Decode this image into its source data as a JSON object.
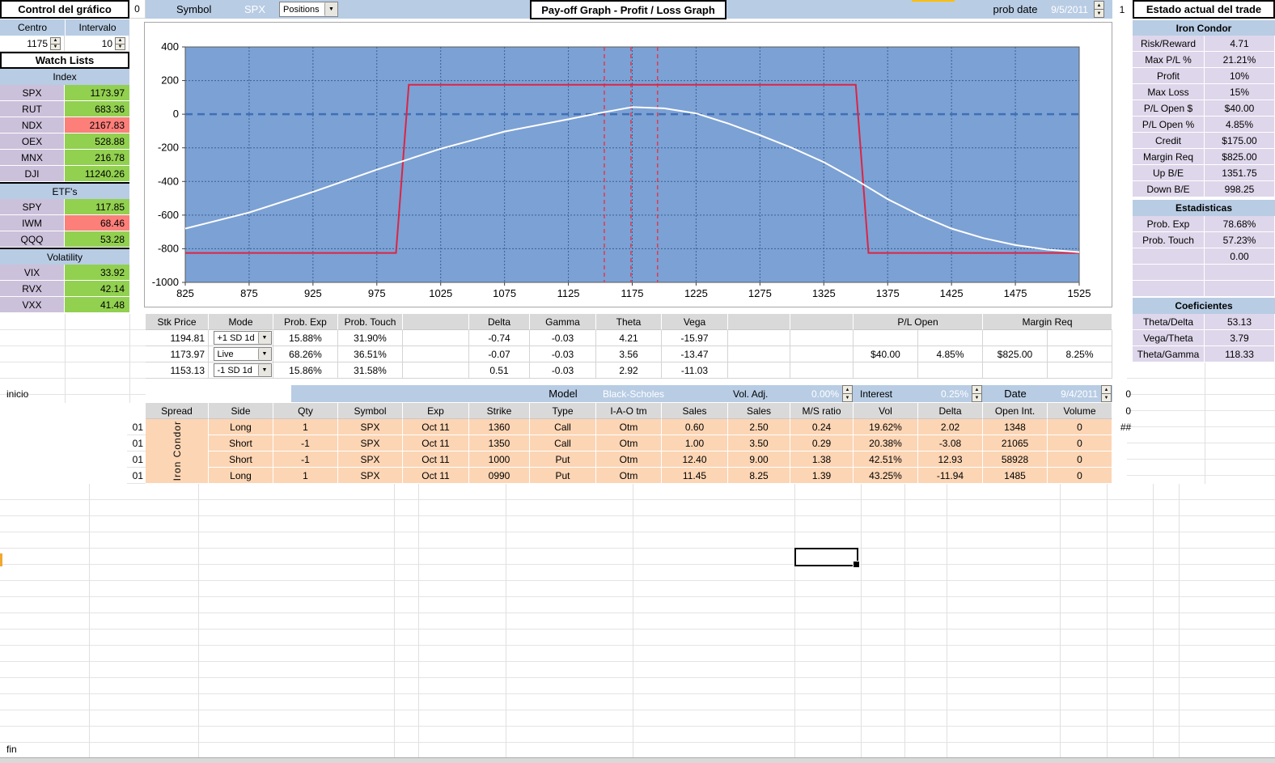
{
  "control_panel": {
    "title": "Control del gráfico",
    "adjacent_cell": "0",
    "centro": {
      "label": "Centro",
      "value": "1175"
    },
    "intervalo": {
      "label": "Intervalo",
      "value": "10"
    }
  },
  "watch_lists": {
    "title": "Watch Lists",
    "sections": [
      {
        "name": "Index",
        "rows": [
          [
            "SPX",
            "1173.97",
            "up"
          ],
          [
            "RUT",
            "683.36",
            "up"
          ],
          [
            "NDX",
            "2167.83",
            "down"
          ],
          [
            "OEX",
            "528.88",
            "up"
          ],
          [
            "MNX",
            "216.78",
            "up"
          ],
          [
            "DJI",
            "11240.26",
            "up"
          ]
        ]
      },
      {
        "name": "ETF's",
        "rows": [
          [
            "SPY",
            "117.85",
            "up"
          ],
          [
            "IWM",
            "68.46",
            "down"
          ],
          [
            "QQQ",
            "53.28",
            "up"
          ]
        ]
      },
      {
        "name": "Volatility",
        "rows": [
          [
            "VIX",
            "33.92",
            "up"
          ],
          [
            "RVX",
            "42.14",
            "up"
          ],
          [
            "VXX",
            "41.48",
            "up"
          ]
        ]
      }
    ]
  },
  "top_bar": {
    "symbol_label": "Symbol",
    "symbol_value": "SPX",
    "view_dropdown": "Positions",
    "graph_title": "Pay-off Graph - Profit / Loss Graph",
    "prob_date_label": "prob date",
    "prob_date_value": "9/5/2011",
    "corner_cell": "1"
  },
  "estado_panel": {
    "title": "Estado actual del trade",
    "strategy": "Iron Condor",
    "rows": [
      [
        "Risk/Reward",
        "4.71"
      ],
      [
        "Max P/L %",
        "21.21%"
      ],
      [
        "Profit",
        "10%"
      ],
      [
        "Max Loss",
        "15%"
      ],
      [
        "P/L Open $",
        "$40.00"
      ],
      [
        "P/L Open %",
        "4.85%"
      ],
      [
        "Credit",
        "$175.00"
      ],
      [
        "Margin Req",
        "$825.00"
      ],
      [
        "Up B/E",
        "1351.75"
      ],
      [
        "Down B/E",
        "998.25"
      ]
    ],
    "estadisticas": {
      "title": "Estadisticas",
      "rows": [
        [
          "Prob. Exp",
          "78.68%"
        ],
        [
          "Prob. Touch",
          "57.23%"
        ],
        [
          "",
          "0.00"
        ],
        [
          "",
          ""
        ],
        [
          "",
          ""
        ]
      ]
    },
    "coeficientes": {
      "title": "Coeficientes",
      "rows": [
        [
          "Theta/Delta",
          "53.13"
        ],
        [
          "Vega/Theta",
          "3.79"
        ],
        [
          "Theta/Gamma",
          "118.33"
        ]
      ]
    }
  },
  "chart_data": {
    "type": "line",
    "title": "Pay-off Graph - Profit / Loss Graph",
    "xlim": [
      825,
      1525
    ],
    "ylim": [
      -1000,
      400
    ],
    "x_tick_step": 50,
    "y_tick_step": 200,
    "plot_bg": "#7CA1D4",
    "grid_color": "#3A5F96",
    "zero_line": {
      "y": 0,
      "color": "#3F6FB5"
    },
    "price_markers": {
      "x": [
        1153.13,
        1173.97,
        1194.81
      ],
      "color": "#E03A50"
    },
    "series": [
      {
        "name": "expiration-payoff",
        "color": "#DC2444",
        "x": [
          825,
          990,
          1000,
          1350,
          1360,
          1525
        ],
        "y": [
          -825,
          -825,
          175,
          175,
          -825,
          -825
        ]
      },
      {
        "name": "current-pl",
        "color": "#FFFFFF",
        "x": [
          825,
          875,
          925,
          975,
          1025,
          1075,
          1125,
          1150,
          1175,
          1200,
          1225,
          1250,
          1275,
          1300,
          1325,
          1350,
          1375,
          1400,
          1425,
          1450,
          1475,
          1500,
          1525
        ],
        "y": [
          -680,
          -585,
          -462,
          -330,
          -205,
          -103,
          -30,
          8,
          42,
          35,
          5,
          -55,
          -125,
          -200,
          -285,
          -390,
          -505,
          -600,
          -680,
          -737,
          -778,
          -805,
          -820
        ]
      }
    ]
  },
  "greeks_table": {
    "headers": [
      "Stk Price",
      "Mode",
      "Prob. Exp",
      "Prob. Touch",
      "Delta",
      "Gamma",
      "Theta",
      "Vega",
      "P/L Open",
      "Margin Req"
    ],
    "rows": [
      {
        "stk": "1194.81",
        "mode": "+1 SD 1d",
        "prob_exp": "15.88%",
        "prob_touch": "31.90%",
        "delta": "-0.74",
        "gamma": "-0.03",
        "theta": "4.21",
        "vega": "-15.97",
        "pl_open_d": "",
        "pl_open_p": "",
        "margin_d": "",
        "margin_p": ""
      },
      {
        "stk": "1173.97",
        "mode": "Live",
        "prob_exp": "68.26%",
        "prob_touch": "36.51%",
        "delta": "-0.07",
        "gamma": "-0.03",
        "theta": "3.56",
        "vega": "-13.47",
        "pl_open_d": "$40.00",
        "pl_open_p": "4.85%",
        "margin_d": "$825.00",
        "margin_p": "8.25%"
      },
      {
        "stk": "1153.13",
        "mode": "-1 SD 1d",
        "prob_exp": "15.86%",
        "prob_touch": "31.58%",
        "delta": "0.51",
        "gamma": "-0.03",
        "theta": "2.92",
        "vega": "-11.03",
        "pl_open_d": "",
        "pl_open_p": "",
        "margin_d": "",
        "margin_p": ""
      }
    ]
  },
  "model_bar": {
    "inicio": "inicio",
    "model_label": "Model",
    "model_value": "Black-Scholes",
    "vol_adj_label": "Vol. Adj.",
    "vol_adj_value": "0.00%",
    "interest_label": "Interest",
    "interest_value": "0.25%",
    "date_label": "Date",
    "date_value": "9/4/2011",
    "right_cell": "0"
  },
  "trade_table": {
    "headers": [
      "Spread",
      "Side",
      "Qty",
      "Symbol",
      "Exp",
      "Strike",
      "Type",
      "I-A-O tm",
      "Sales",
      "Sales",
      "M/S ratio",
      "Vol",
      "Delta",
      "Open Int.",
      "Volume"
    ],
    "spread_name": "Iron Condor",
    "row_prefix": "01",
    "header_right_cell": "0",
    "overflow_cell": "##",
    "rows": [
      [
        "Long",
        "1",
        "SPX",
        "Oct 11",
        "1360",
        "Call",
        "Otm",
        "0.60",
        "2.50",
        "0.24",
        "19.62%",
        "2.02",
        "1348",
        "0"
      ],
      [
        "Short",
        "-1",
        "SPX",
        "Oct 11",
        "1350",
        "Call",
        "Otm",
        "1.00",
        "3.50",
        "0.29",
        "20.38%",
        "-3.08",
        "21065",
        "0"
      ],
      [
        "Short",
        "-1",
        "SPX",
        "Oct 11",
        "1000",
        "Put",
        "Otm",
        "12.40",
        "9.00",
        "1.38",
        "42.51%",
        "12.93",
        "58928",
        "0"
      ],
      [
        "Long",
        "1",
        "SPX",
        "Oct 11",
        "0990",
        "Put",
        "Otm",
        "11.45",
        "8.25",
        "1.39",
        "43.25%",
        "-11.94",
        "1485",
        "0"
      ]
    ]
  },
  "footer": {
    "fin": "fin"
  }
}
